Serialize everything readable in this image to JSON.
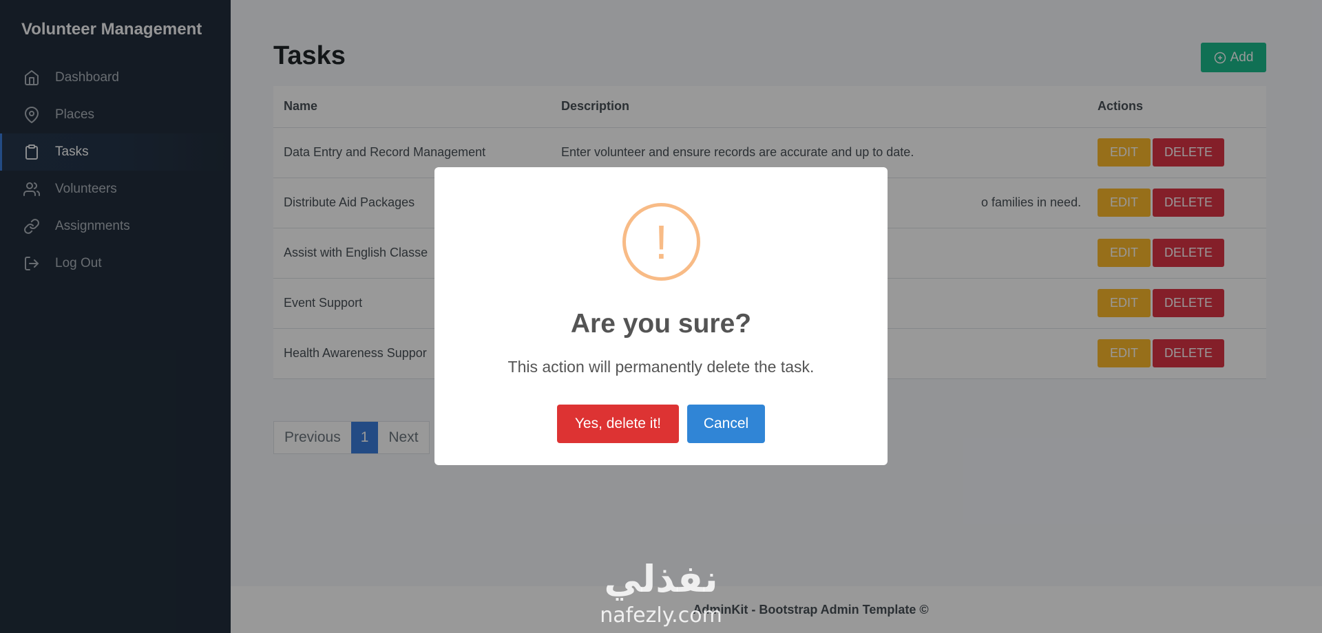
{
  "app": {
    "brand": "Volunteer Management"
  },
  "sidebar": {
    "items": [
      {
        "label": "Dashboard",
        "icon": "home-icon",
        "active": false
      },
      {
        "label": "Places",
        "icon": "map-pin-icon",
        "active": false
      },
      {
        "label": "Tasks",
        "icon": "clipboard-icon",
        "active": true
      },
      {
        "label": "Volunteers",
        "icon": "users-icon",
        "active": false
      },
      {
        "label": "Assignments",
        "icon": "link-icon",
        "active": false
      },
      {
        "label": "Log Out",
        "icon": "log-out-icon",
        "active": false
      }
    ]
  },
  "main": {
    "title": "Tasks",
    "add_label": "Add",
    "table": {
      "headers": [
        "Name",
        "Description",
        "Actions"
      ],
      "rows": [
        {
          "name": "Data Entry and Record Management",
          "description": "Enter volunteer and ensure records are accurate and up to date."
        },
        {
          "name": "Distribute Aid Packages",
          "description": "o families in need."
        },
        {
          "name": "Assist with English Classe",
          "description": ""
        },
        {
          "name": "Event Support",
          "description": ""
        },
        {
          "name": "Health Awareness Suppor",
          "description": ""
        }
      ],
      "edit_label": "EDIT",
      "delete_label": "DELETE"
    },
    "pagination": {
      "previous": "Previous",
      "current": "1",
      "next": "Next"
    },
    "footer": "AdminKit - Bootstrap Admin Template ©"
  },
  "modal": {
    "icon_glyph": "!",
    "title": "Are you sure?",
    "text": "This action will permanently delete the task.",
    "confirm_label": "Yes, delete it!",
    "cancel_label": "Cancel"
  },
  "watermark": {
    "arabic": "نفذلي",
    "latin": "nafezly.com"
  },
  "colors": {
    "sidebar_bg": "#222e3c",
    "primary": "#3b7ddd",
    "success": "#1cbb8c",
    "warning": "#fcb92c",
    "danger": "#dc3545",
    "confirm": "#dd3333",
    "cancel": "#3085d6",
    "warning_icon": "#f8bb86"
  }
}
